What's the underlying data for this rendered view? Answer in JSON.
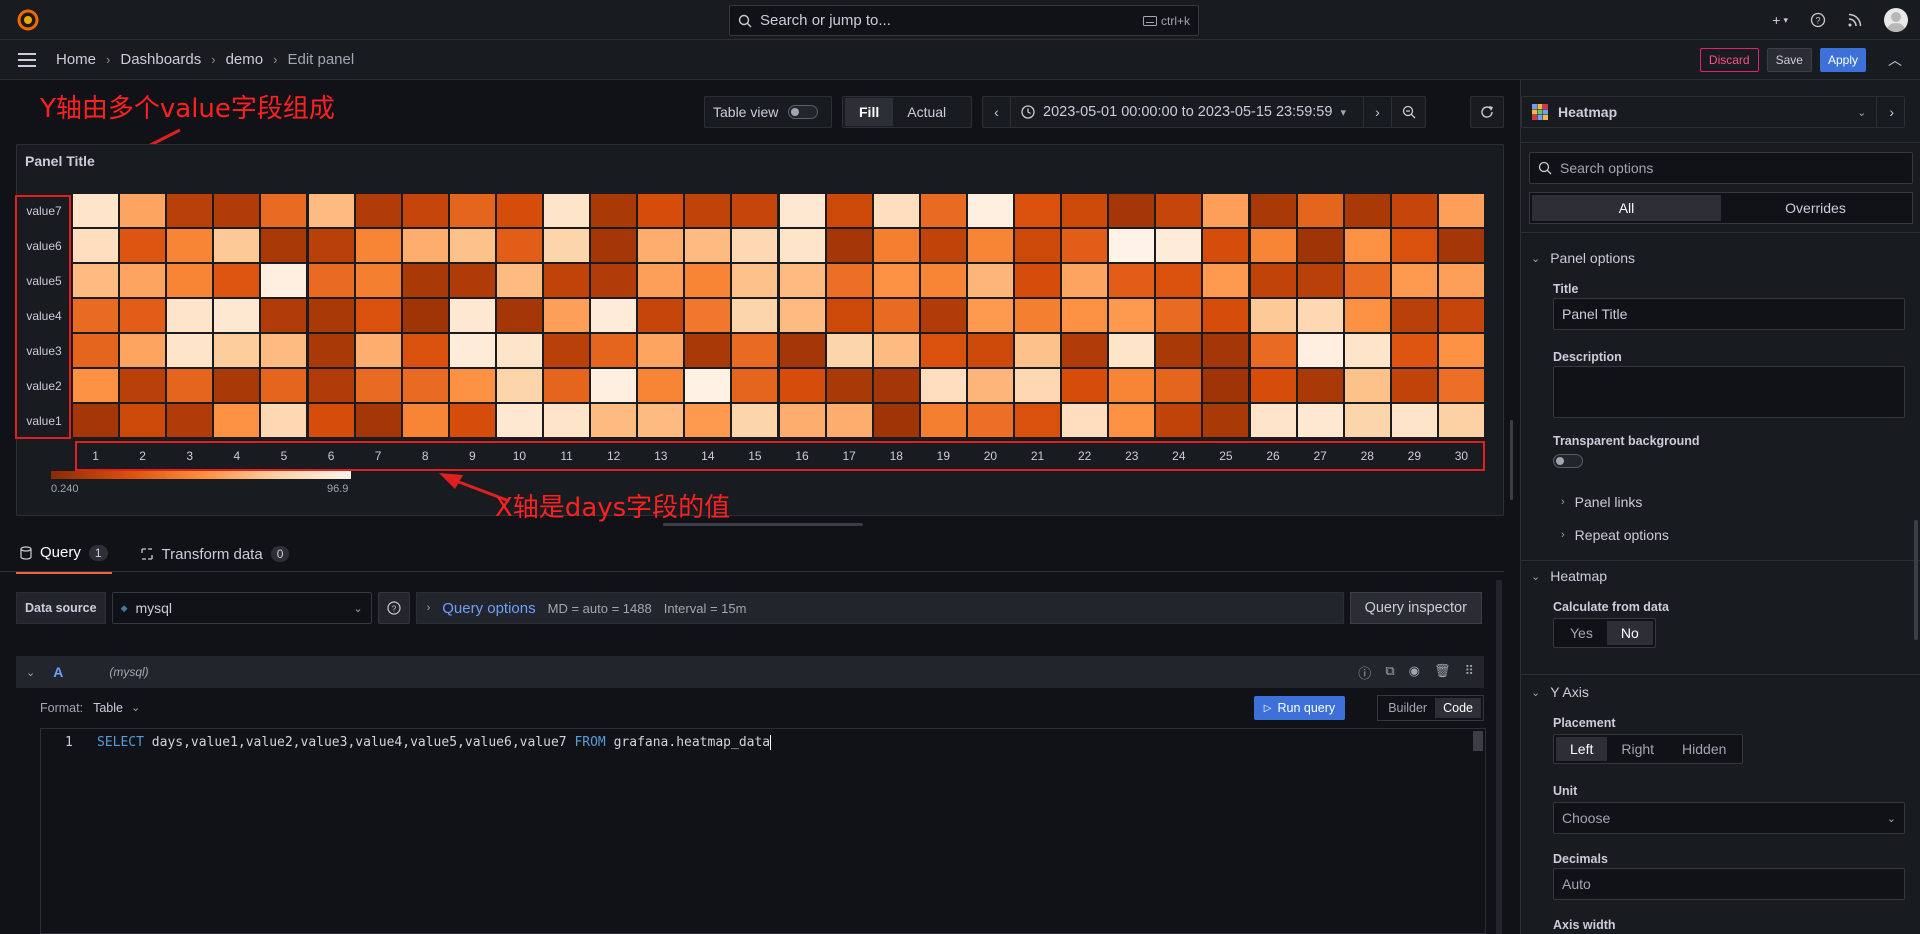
{
  "topbar": {
    "search_placeholder": "Search or jump to...",
    "search_shortcut": "ctrl+k"
  },
  "breadcrumb": [
    "Home",
    "Dashboards",
    "demo",
    "Edit panel"
  ],
  "nav_buttons": {
    "discard": "Discard",
    "save": "Save",
    "apply": "Apply"
  },
  "annotations": {
    "y_axis_note": "Y轴由多个value字段组成",
    "x_axis_note": "X轴是days字段的值"
  },
  "toolbar": {
    "table_view": "Table view",
    "fill": "Fill",
    "actual": "Actual",
    "time_range": "2023-05-01 00:00:00 to 2023-05-15 23:59:59"
  },
  "visualization": {
    "name": "Heatmap"
  },
  "panel": {
    "title": "Panel Title"
  },
  "chart_data": {
    "type": "heatmap",
    "y_categories": [
      "value7",
      "value6",
      "value5",
      "value4",
      "value3",
      "value2",
      "value1"
    ],
    "x_categories": [
      "1",
      "2",
      "3",
      "4",
      "5",
      "6",
      "7",
      "8",
      "9",
      "10",
      "11",
      "12",
      "13",
      "14",
      "15",
      "16",
      "17",
      "18",
      "19",
      "20",
      "21",
      "22",
      "23",
      "24",
      "25",
      "26",
      "27",
      "28",
      "29",
      "30"
    ],
    "color_scale": {
      "min": 0.24,
      "max": 96.9,
      "min_label": "0.240",
      "max_label": "96.9",
      "low_color": "#8a2a06",
      "high_color": "#fff5eb"
    },
    "values": [
      [
        88,
        62,
        18,
        15,
        40,
        70,
        15,
        22,
        38,
        28,
        88,
        12,
        28,
        20,
        22,
        90,
        25,
        85,
        40,
        94,
        30,
        25,
        10,
        22,
        60,
        12,
        38,
        12,
        22,
        60
      ],
      [
        85,
        32,
        50,
        75,
        12,
        18,
        50,
        65,
        72,
        35,
        80,
        10,
        65,
        70,
        82,
        88,
        10,
        48,
        20,
        50,
        25,
        35,
        96,
        92,
        28,
        50,
        8,
        55,
        30,
        10
      ],
      [
        70,
        62,
        50,
        32,
        94,
        40,
        48,
        12,
        14,
        70,
        20,
        15,
        60,
        50,
        72,
        70,
        42,
        55,
        50,
        68,
        28,
        62,
        35,
        30,
        58,
        20,
        18,
        40,
        58,
        60
      ],
      [
        40,
        35,
        88,
        90,
        15,
        12,
        30,
        8,
        90,
        10,
        60,
        92,
        22,
        45,
        80,
        70,
        25,
        40,
        15,
        58,
        48,
        55,
        58,
        40,
        28,
        75,
        82,
        55,
        18,
        22
      ],
      [
        38,
        62,
        88,
        76,
        70,
        12,
        65,
        30,
        92,
        88,
        18,
        38,
        62,
        12,
        40,
        10,
        80,
        70,
        30,
        25,
        72,
        15,
        88,
        12,
        10,
        40,
        94,
        88,
        32,
        55
      ],
      [
        55,
        18,
        38,
        12,
        38,
        15,
        40,
        40,
        55,
        80,
        38,
        94,
        50,
        95,
        38,
        28,
        12,
        10,
        85,
        68,
        82,
        28,
        50,
        38,
        8,
        28,
        12,
        72,
        20,
        42
      ],
      [
        10,
        25,
        15,
        55,
        82,
        28,
        10,
        50,
        28,
        90,
        88,
        70,
        70,
        58,
        80,
        65,
        65,
        8,
        48,
        42,
        30,
        85,
        55,
        20,
        12,
        88,
        90,
        80,
        88,
        78
      ]
    ]
  },
  "query_tabs": [
    {
      "label": "Query",
      "count": "1"
    },
    {
      "label": "Transform data",
      "count": "0"
    }
  ],
  "query": {
    "data_source_label": "Data source",
    "data_source": "mysql",
    "options_label": "Query options",
    "md": "MD = auto = 1488",
    "interval": "Interval = 15m",
    "inspector": "Query inspector",
    "ref_id": "A",
    "ds_tag": "(mysql)",
    "format_label": "Format:",
    "format_value": "Table",
    "run": "Run query",
    "builder": "Builder",
    "code": "Code",
    "line_no": "1",
    "sql_kw1": "SELECT",
    "sql_cols": "days,value1,value2,value3,value4,value5,value6,value7",
    "sql_kw2": "FROM",
    "sql_table": "grafana.heatmap_data"
  },
  "options": {
    "search_placeholder": "Search options",
    "tab_all": "All",
    "tab_overrides": "Overrides",
    "panel_options": "Panel options",
    "title_label": "Title",
    "title_value": "Panel Title",
    "description_label": "Description",
    "transparent_label": "Transparent background",
    "panel_links": "Panel links",
    "repeat_options": "Repeat options",
    "heatmap_section": "Heatmap",
    "calc_label": "Calculate from data",
    "calc_yes": "Yes",
    "calc_no": "No",
    "yaxis_section": "Y Axis",
    "placement_label": "Placement",
    "placement_left": "Left",
    "placement_right": "Right",
    "placement_hidden": "Hidden",
    "unit_label": "Unit",
    "unit_placeholder": "Choose",
    "decimals_label": "Decimals",
    "decimals_placeholder": "Auto",
    "axis_width_label": "Axis width"
  }
}
